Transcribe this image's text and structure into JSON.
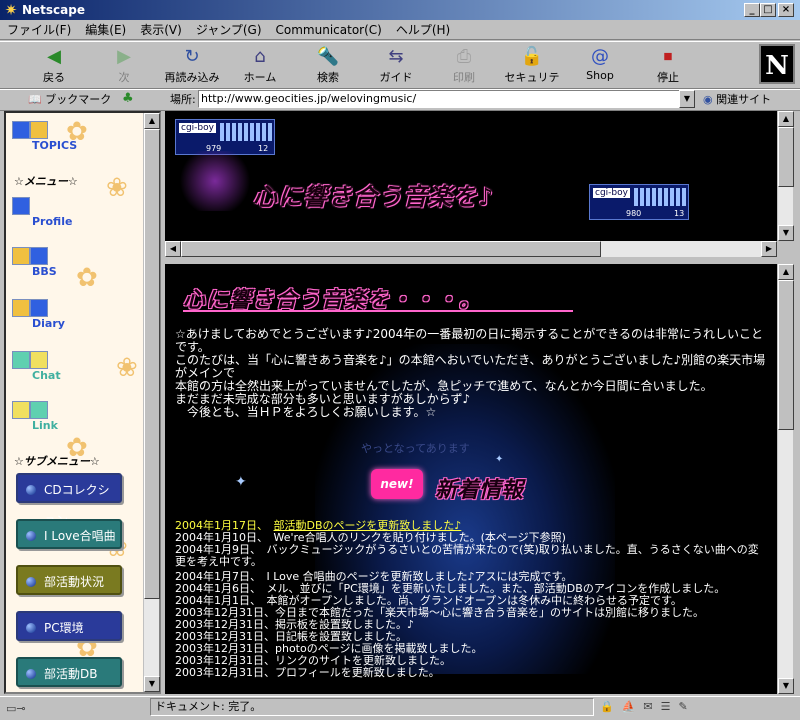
{
  "window": {
    "title": "Netscape"
  },
  "menu": [
    "ファイル(F)",
    "編集(E)",
    "表示(V)",
    "ジャンプ(G)",
    "Communicator(C)",
    "ヘルプ(H)"
  ],
  "toolbar": [
    {
      "label": "戻る",
      "icon": "back-arrow-icon",
      "enabled": true
    },
    {
      "label": "次",
      "icon": "forward-arrow-icon",
      "enabled": false
    },
    {
      "label": "再読み込み",
      "icon": "reload-icon",
      "enabled": true
    },
    {
      "label": "ホーム",
      "icon": "home-icon",
      "enabled": true
    },
    {
      "label": "検索",
      "icon": "search-icon",
      "enabled": true
    },
    {
      "label": "ガイド",
      "icon": "guide-icon",
      "enabled": true
    },
    {
      "label": "印刷",
      "icon": "print-icon",
      "enabled": false
    },
    {
      "label": "セキュリティ",
      "icon": "lock-icon",
      "enabled": true
    },
    {
      "label": "Shop",
      "icon": "shop-icon",
      "enabled": true
    },
    {
      "label": "停止",
      "icon": "stop-icon",
      "enabled": true
    }
  ],
  "brand": {
    "letter": "N"
  },
  "location": {
    "bookmark_label": "ブックマーク",
    "location_label": "場所:",
    "url": "http://www.geocities.jp/welovingmusic/",
    "related_label": "関連サイト"
  },
  "left": {
    "nav": [
      {
        "label": "TOPICS",
        "color": "#2a4fd0"
      },
      {
        "label": "Profile",
        "color": "#2a4fd0"
      },
      {
        "label": "BBS",
        "color": "#2a4fd0"
      },
      {
        "label": "Diary",
        "color": "#2a4fd0"
      },
      {
        "label": "Chat",
        "color": "#40b0a0"
      },
      {
        "label": "Link",
        "color": "#40b0a0"
      }
    ],
    "menu_head": "☆メニュー☆",
    "sub_head": "☆サブメニュー☆",
    "sub": [
      {
        "label": "CDコレクション",
        "color": "#2a3a9a"
      },
      {
        "label": "I Love合唱曲",
        "color": "#2a7a7a"
      },
      {
        "label": "部活動状況",
        "color": "#7a7a20"
      },
      {
        "label": "PC環境",
        "color": "#2a3a9a"
      },
      {
        "label": "部活動DB",
        "color": "#2a7a7a"
      }
    ]
  },
  "top": {
    "banner": "心に響き合う音楽を♪",
    "counter1": {
      "logo": "cgi-boy",
      "count1": "979",
      "count2": "12"
    },
    "counter2": {
      "logo": "cgi-boy",
      "count1": "980",
      "count2": "13"
    }
  },
  "main": {
    "heading": "心に響き合う音楽を・・・。",
    "intro": "☆あけましておめでとうございます♪2004年の一番最初の日に掲示することができるのは非常にうれしいことです。\nこのたびは、当「心に響きあう音楽を♪」の本館へおいでいただき、ありがとうございました♪別館の楽天市場がメインで\n本館の方は全然出来上がっていませんでしたが、急ピッチで進めて、なんとか今日間に合いました。\nまだまだ未完成な部分も多いと思いますがあしからず♪\n　今後とも、当ＨＰをよろしくお願いします。☆",
    "faint": "やっとなってあります",
    "new_badge": "new!",
    "news_title": "新着情報",
    "news": [
      {
        "date": "2004年1月17日、",
        "text": "部活動DBのページを更新致しました♪",
        "color": "#ffff40"
      },
      {
        "date": "2004年1月10日、",
        "text": "We're合唱人のリンクを貼り付けました。(本ページ下参照)",
        "color": "#ffffff"
      },
      {
        "date": "2004年1月9日、",
        "text": "バックミュージックがうるさいとの苦情が来たので(笑)取り払いました。直、うるさくない曲への変更を考え中です。",
        "color": "#ffffff"
      },
      {
        "date": "2004年1月7日、",
        "text": "I Love 合唱曲のページを更新致しました♪アスには完成です。",
        "color": "#ffffff"
      },
      {
        "date": "2004年1月6日、",
        "text": "メル、並びに「PC環境」を更新いたしました。また、部活動DBのアイコンを作成しました。",
        "color": "#ffffff"
      },
      {
        "date": "2004年1月1日、",
        "text": "本館がオープンしました。尚、グランドオープンは冬休み中に終わらせる予定です。",
        "color": "#ffffff"
      },
      {
        "date": "2003年12月31日、",
        "text": "今日まで本館だった「楽天市場～心に響き合う音楽を」のサイトは別館に移りました。",
        "color": "#ffffff"
      },
      {
        "date": "2003年12月31日、",
        "text": "掲示板を設置致しました。♪",
        "color": "#ffffff"
      },
      {
        "date": "2003年12月31日、",
        "text": "日記帳を設置致しました。",
        "color": "#ffffff"
      },
      {
        "date": "2003年12月31日、",
        "text": "photoのページに画像を掲載致しました。",
        "color": "#ffffff"
      },
      {
        "date": "2003年12月31日、",
        "text": "リンクのサイトを更新致しました。",
        "color": "#ffffff"
      },
      {
        "date": "2003年12月31日、",
        "text": "プロフィールを更新致しました。",
        "color": "#ffffff"
      }
    ]
  },
  "status": {
    "text": "ドキュメント: 完了。"
  },
  "colors": {
    "accent": "#ff66cc",
    "news_highlight": "#ffff40",
    "frame_bg": "#000000"
  }
}
